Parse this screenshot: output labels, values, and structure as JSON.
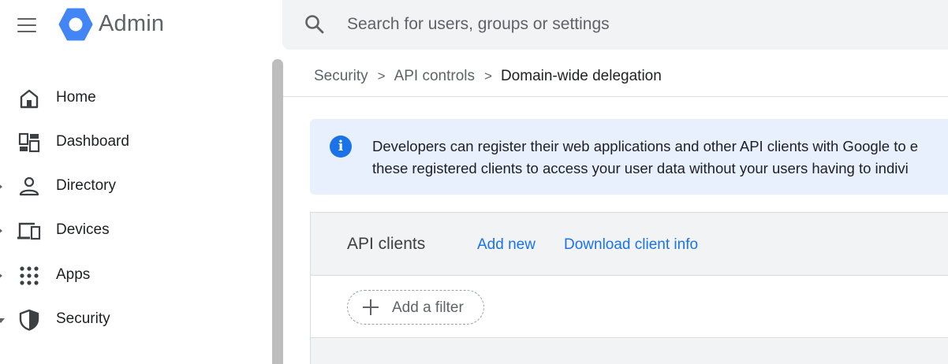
{
  "header": {
    "app_title": "Admin",
    "menu_icon": "hamburger-menu-icon",
    "logo_icon": "google-admin-hexagon-logo",
    "brand_color": "#4285f4"
  },
  "search": {
    "placeholder": "Search for users, groups or settings",
    "value": "",
    "icon": "search-icon"
  },
  "sidebar": {
    "items": [
      {
        "label": "Home",
        "icon": "home-icon",
        "expander": "none"
      },
      {
        "label": "Dashboard",
        "icon": "dashboard-icon",
        "expander": "none"
      },
      {
        "label": "Directory",
        "icon": "person-icon",
        "expander": "collapsed"
      },
      {
        "label": "Devices",
        "icon": "devices-icon",
        "expander": "collapsed"
      },
      {
        "label": "Apps",
        "icon": "apps-grid-icon",
        "expander": "collapsed"
      },
      {
        "label": "Security",
        "icon": "shield-icon",
        "expander": "expanded"
      }
    ]
  },
  "breadcrumb": {
    "items": [
      "Security",
      "API controls",
      "Domain-wide delegation"
    ],
    "separator": ">"
  },
  "banner": {
    "icon": "info-icon",
    "line1": "Developers can register their web applications and other API clients with Google to e",
    "line2": "these registered clients to access your user data without your users having to indivi",
    "background": "#e8f0fe",
    "icon_color": "#1a73e8"
  },
  "api_clients": {
    "title": "API clients",
    "add_new_label": "Add new",
    "download_label": "Download client info",
    "filter_label": "Add a filter",
    "link_color": "#1a73e8"
  }
}
